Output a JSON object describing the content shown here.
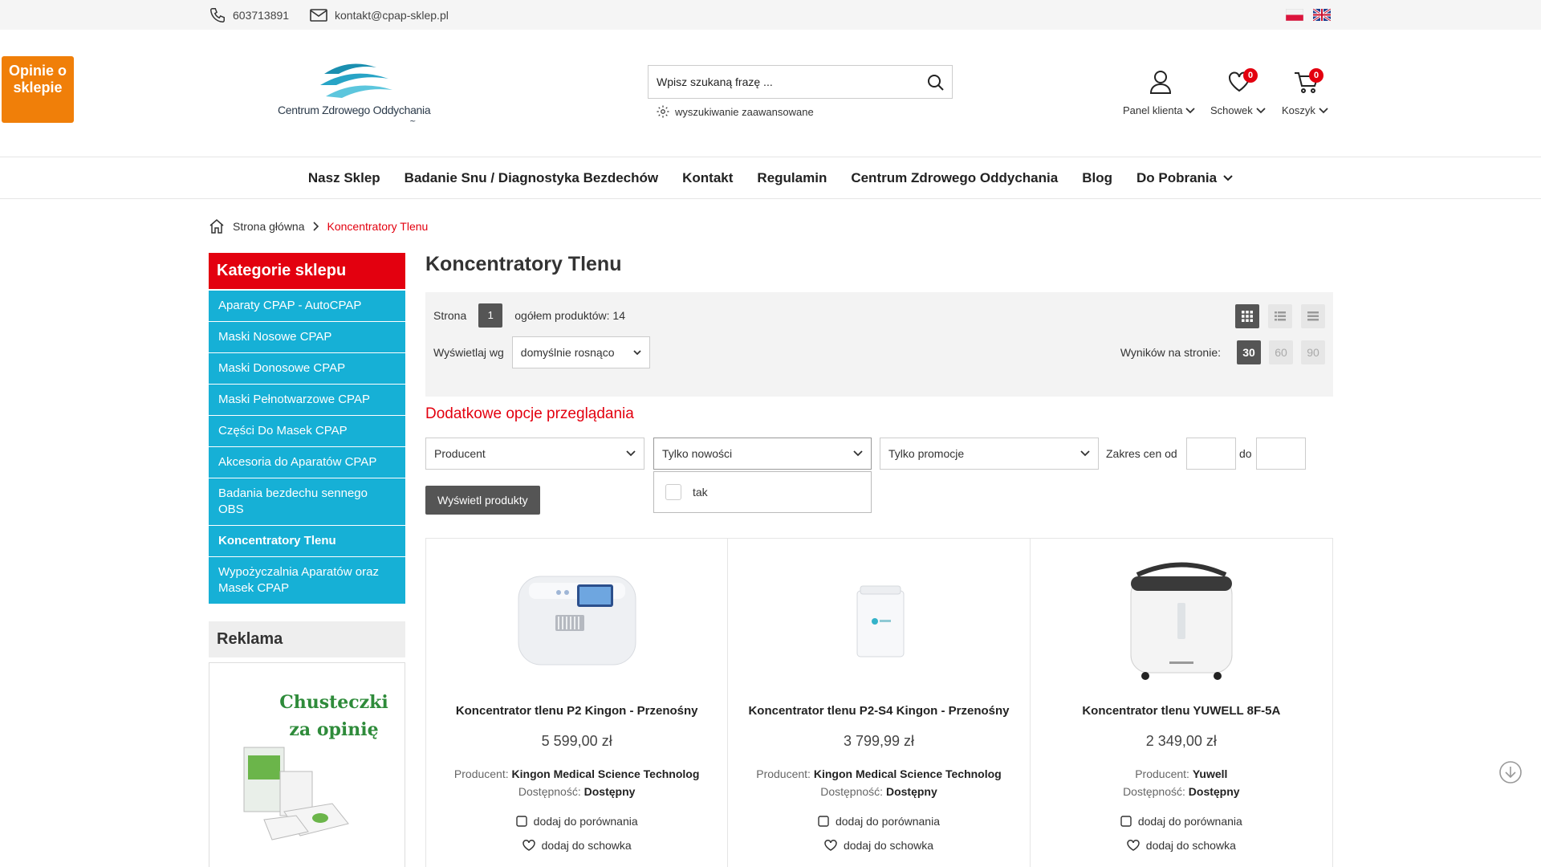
{
  "topbar": {
    "phone": "603713891",
    "email": "kontakt@cpap-sklep.pl"
  },
  "opinie": {
    "label": "Opinie o sklepie"
  },
  "logo": {
    "text": "Centrum Zdrowego Oddychania"
  },
  "search": {
    "placeholder": "Wpisz szukaną frazę ...",
    "advanced": "wyszukiwanie zaawansowane"
  },
  "header_icons": {
    "panel": "Panel klienta",
    "schowek": "Schowek",
    "schowek_count": "0",
    "koszyk": "Koszyk",
    "koszyk_count": "0"
  },
  "nav": [
    "Nasz Sklep",
    "Badanie Snu / Diagnostyka Bezdechów",
    "Kontakt",
    "Regulamin",
    "Centrum Zdrowego Oddychania",
    "Blog",
    "Do Pobrania"
  ],
  "breadcrumb": {
    "home": "Strona główna",
    "current": "Koncentratory Tlenu"
  },
  "sidebar": {
    "title": "Kategorie sklepu",
    "items": [
      "Aparaty CPAP - AutoCPAP",
      "Maski Nosowe CPAP",
      "Maski Donosowe CPAP",
      "Maski Pełnotwarzowe CPAP",
      "Części Do Masek CPAP",
      "Akcesoria do Aparatów CPAP",
      "Badania bezdechu sennego OBS",
      "Koncentratory Tlenu",
      "Wypożyczalnia Aparatów oraz Masek CPAP"
    ],
    "reklama_title": "Reklama",
    "reklama_text": "Chusteczki za opinię"
  },
  "main": {
    "title": "Koncentratory Tlenu",
    "page_label": "Strona",
    "page_num": "1",
    "total": "ogółem produktów: 14",
    "sort_label": "Wyświetlaj wg",
    "sort_value": "domyślnie rosnąco",
    "perpage_label": "Wyników na stronie:",
    "perpage": [
      "30",
      "60",
      "90"
    ],
    "extra_title": "Dodatkowe opcje przeglądania",
    "filter_producer": "Producent",
    "filter_new": "Tylko nowości",
    "filter_promo": "Tylko promocje",
    "price_from": "Zakres cen od",
    "price_to": "do",
    "dropdown_option": "tak",
    "show_button": "Wyświetl produkty"
  },
  "products": [
    {
      "name": "Koncentrator tlenu P2 Kingon - Przenośny",
      "price": "5 599,00 zł",
      "producer_label": "Producent:",
      "producer": "Kingon Medical Science Technolog",
      "avail_label": "Dostępność:",
      "avail": "Dostępny",
      "compare": "dodaj do porównania",
      "wishlist": "dodaj do schowka"
    },
    {
      "name": "Koncentrator tlenu P2-S4 Kingon - Przenośny",
      "price": "3 799,99 zł",
      "producer_label": "Producent:",
      "producer": "Kingon Medical Science Technolog",
      "avail_label": "Dostępność:",
      "avail": "Dostępny",
      "compare": "dodaj do porównania",
      "wishlist": "dodaj do schowka"
    },
    {
      "name": "Koncentrator tlenu YUWELL 8F-5A",
      "price": "2 349,00 zł",
      "producer_label": "Producent:",
      "producer": "Yuwell",
      "avail_label": "Dostępność:",
      "avail": "Dostępny",
      "compare": "dodaj do porównania",
      "wishlist": "dodaj do schowka"
    }
  ],
  "colors": {
    "accent_red": "#e3000f",
    "sidebar_blue": "#16b0d6",
    "opinie_orange": "#f07f09"
  }
}
